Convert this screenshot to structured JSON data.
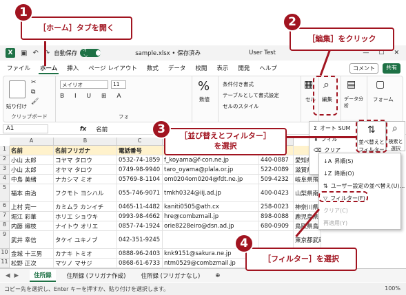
{
  "window": {
    "autosave_label": "自動保存",
    "autosave_state": "オン",
    "filename": "sample.xlsx • 保存済み",
    "user": "User Test"
  },
  "menu": [
    "ファイル",
    "ホーム",
    "挿入",
    "ページ レイアウト",
    "数式",
    "データ",
    "校閲",
    "表示",
    "開発",
    "ヘルプ"
  ],
  "comment_btn": "コメント",
  "share_btn": "共有",
  "ribbon": {
    "clipboard_group": "クリップボード",
    "paste_label": "貼り付け",
    "font_name": "メイリオ",
    "font_size": "11",
    "font_group": "フォ",
    "percent_label": "数値",
    "cond_format": "条件付き書式",
    "table_format": "テーブルとして書式設定",
    "cell_style": "セルのスタイル",
    "cells_group": "セル",
    "edit_label": "編集",
    "analysis_label": "データ分析",
    "form_label": "フォーム",
    "form_group": "フォーム"
  },
  "formula": {
    "namebox": "A1",
    "value": "名前"
  },
  "columns": [
    "A",
    "B",
    "C",
    "D",
    "E"
  ],
  "grid_header": [
    "名前",
    "名前フリガナ",
    "電話番号",
    "",
    "住所"
  ],
  "grid_rows": [
    {
      "n": "2",
      "a": "小山 太郎",
      "b": "コヤマ タロウ",
      "c": "0532-74-1859",
      "d": "f_koyama@f-con.ne.jp",
      "e": "440-0887",
      "f": "愛知県"
    },
    {
      "n": "3",
      "a": "小山 太郎",
      "b": "オヤマ タロウ",
      "c": "0749-98-9940",
      "d": "taro_oyama@plala.or.jp",
      "e": "522-0089",
      "f": "滋賀県彦"
    },
    {
      "n": "4",
      "a": "中島 美緒",
      "b": "ナカシマ ミオ",
      "c": "05769-8-1104",
      "d": "om0204om0204@fdt.ne.jp",
      "e": "509-4232",
      "f": "岐阜県飛"
    },
    {
      "n": "5",
      "a": "福本 由治",
      "b": "フクモト ヨシハル",
      "c": "055-746-9071",
      "d": "tmkh0324@iij.ad.jp",
      "e": "400-0423",
      "f": "山梨県南 落合 5階"
    },
    {
      "n": "6",
      "a": "上村 完一",
      "b": "カミムラ カンイチ",
      "c": "0465-11-4482",
      "d": "kaniti0505@ath.cx",
      "e": "258-0023",
      "f": "神奈川県"
    },
    {
      "n": "7",
      "a": "堀江 彩華",
      "b": "ホリエ ショウキ",
      "c": "0993-98-4662",
      "d": "hre@combzmail.jp",
      "e": "898-0088",
      "f": "鹿児島県"
    },
    {
      "n": "8",
      "a": "内藤 織枝",
      "b": "ナイトウ オリエ",
      "c": "0857-74-1924",
      "d": "orie8228eiro@dsn.ad.jp",
      "e": "680-0909",
      "f": "鳥取県鳥"
    },
    {
      "n": "9",
      "a": "武井 幸信",
      "b": "タケイ ユキノブ",
      "c": "042-351-9245",
      "d": "",
      "e": "",
      "f": "東京都武蔵村山市榎2-14-7 マンション"
    },
    {
      "n": "10",
      "a": "金城 十三男",
      "b": "カナキ トミオ",
      "c": "0888-96-2403",
      "d": "knk9151@sakura.ne.jp",
      "e": "",
      "f": "9-15-1"
    },
    {
      "n": "11",
      "a": "松野 正次",
      "b": "マツノ マサジ",
      "c": "0868-61-6733",
      "d": "ntm0529@combzmail.jp",
      "e": "",
      "f": "18 プレジールA"
    }
  ],
  "menu_edit": {
    "autosum": "オート SUM",
    "fill": "フィル",
    "clear": "クリア",
    "sort_filter": "並べ替えと フィルター",
    "find_select": "検索と 選択"
  },
  "menu_sort": {
    "asc": "昇順(S)",
    "desc": "降順(O)",
    "custom": "ユーザー設定の並べ替え(U)...",
    "filter": "フィルター(F)",
    "clear": "クリア(C)",
    "reapply": "再適用(Y)"
  },
  "sheet_tabs": [
    "住所録",
    "住所録 (フリガナ作成)",
    "住所録 (フリガナなし)"
  ],
  "status": {
    "text": "コピー先を選択し、Enter キーを押すか、貼り付けを選択します。",
    "zoom": "100%"
  },
  "callouts": {
    "c1_num": "1",
    "c1_text": "［ホーム］タブを開く",
    "c2_num": "2",
    "c2_text": "［編集］をクリック",
    "c3_num": "3",
    "c3_line1": "［並び替えとフィルター］",
    "c3_line2": "を選択",
    "c4_num": "4",
    "c4_text": "［フィルター］を選択"
  }
}
